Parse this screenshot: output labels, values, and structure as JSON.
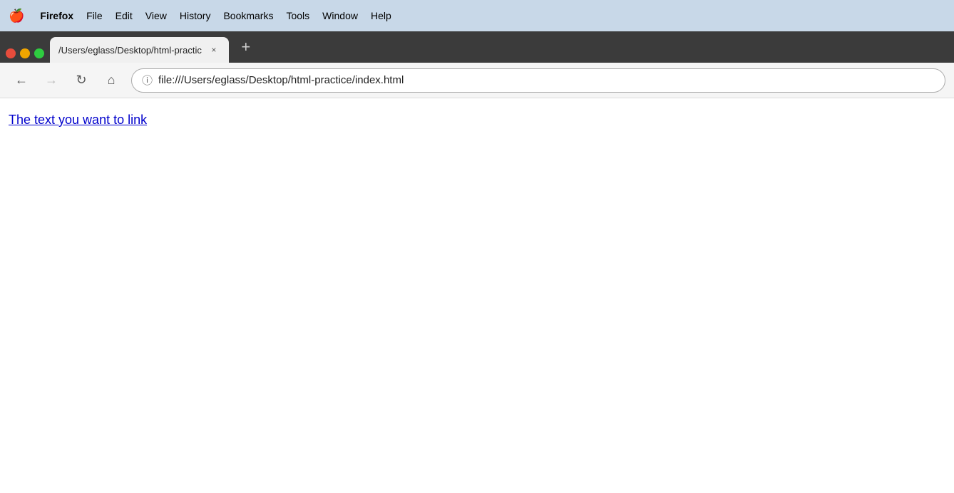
{
  "menubar": {
    "apple": "🍎",
    "items": [
      {
        "label": "Firefox",
        "bold": true
      },
      {
        "label": "File"
      },
      {
        "label": "Edit"
      },
      {
        "label": "View"
      },
      {
        "label": "History"
      },
      {
        "label": "Bookmarks"
      },
      {
        "label": "Tools"
      },
      {
        "label": "Window"
      },
      {
        "label": "Help"
      }
    ]
  },
  "tabbar": {
    "tab": {
      "title": "/Users/eglass/Desktop/html-practic",
      "close_icon": "×"
    },
    "new_tab_icon": "+"
  },
  "navbar": {
    "back_icon": "←",
    "forward_icon": "→",
    "reload_icon": "↻",
    "home_icon": "⌂",
    "info_icon": "ⓘ",
    "address": "file:///Users/eglass/Desktop/html-practice/index.html"
  },
  "page": {
    "link_text": "The text you want to link"
  }
}
